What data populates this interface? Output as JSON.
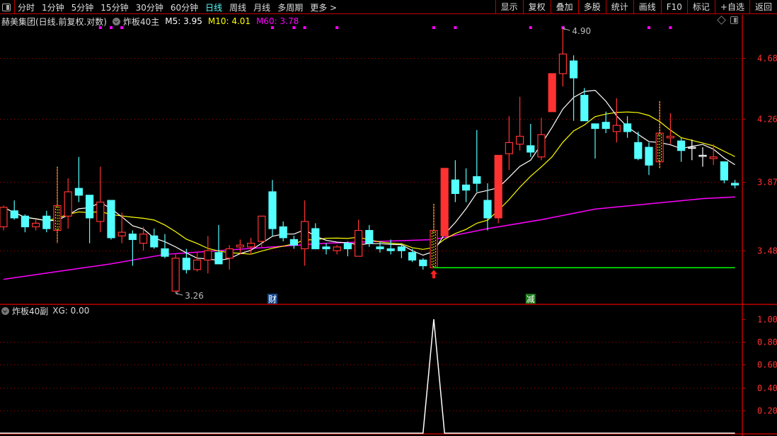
{
  "toolbar": {
    "periods": [
      "分时",
      "1分钟",
      "5分钟",
      "15分钟",
      "30分钟",
      "60分钟",
      "日线",
      "周线",
      "月线",
      "多周期",
      "更多 >"
    ],
    "active_period": "日线",
    "buttons": [
      "显示",
      "复权",
      "叠加",
      "多股",
      "统计",
      "画线",
      "F10",
      "标记",
      "+自选",
      "返回"
    ]
  },
  "main_panel": {
    "title": "赫美集团(日线.前复权.对数)",
    "indicator": "炸板40主",
    "ma5_label": "M5: 3.95",
    "ma10_label": "M10: 4.01",
    "ma60_label": "M60: 3.78"
  },
  "sub_panel": {
    "indicator": "炸板40副",
    "xg_label": "XG: 0.00"
  },
  "colors": {
    "up": "#ff3232",
    "down": "#54ffff",
    "ma5": "#ffffff",
    "ma10": "#ffff00",
    "ma60": "#ff00ff",
    "grid": "#b00000",
    "signal_line": "#00ff00"
  },
  "chart_data": [
    {
      "type": "candlestick",
      "scale": "log",
      "y_ticks": [
        "4.68",
        "4.26",
        "3.87",
        "3.48"
      ],
      "ylim": [
        3.2,
        5.0
      ],
      "candles_ohlc": [
        [
          3.61,
          3.73,
          3.59,
          3.72
        ],
        [
          3.7,
          3.76,
          3.65,
          3.66
        ],
        [
          3.67,
          3.68,
          3.58,
          3.61
        ],
        [
          3.61,
          3.65,
          3.59,
          3.63
        ],
        [
          3.67,
          3.7,
          3.58,
          3.6
        ],
        [
          3.59,
          3.96,
          3.52,
          3.73
        ],
        [
          3.67,
          3.89,
          3.6,
          3.81
        ],
        [
          3.83,
          4.02,
          3.75,
          3.79
        ],
        [
          3.79,
          3.79,
          3.52,
          3.66
        ],
        [
          3.64,
          3.96,
          3.58,
          3.75
        ],
        [
          3.76,
          3.76,
          3.54,
          3.55
        ],
        [
          3.56,
          3.69,
          3.52,
          3.58
        ],
        [
          3.57,
          3.59,
          3.4,
          3.54
        ],
        [
          3.52,
          3.61,
          3.48,
          3.57
        ],
        [
          3.56,
          3.6,
          3.49,
          3.5
        ],
        [
          3.49,
          3.57,
          3.44,
          3.45
        ],
        [
          3.27,
          3.46,
          3.26,
          3.44
        ],
        [
          3.44,
          3.49,
          3.36,
          3.38
        ],
        [
          3.38,
          3.47,
          3.37,
          3.43
        ],
        [
          3.43,
          3.56,
          3.36,
          3.48
        ],
        [
          3.47,
          3.62,
          3.41,
          3.41
        ],
        [
          3.44,
          3.51,
          3.38,
          3.49
        ],
        [
          3.5,
          3.54,
          3.46,
          3.51
        ],
        [
          3.5,
          3.55,
          3.46,
          3.52
        ],
        [
          3.53,
          3.67,
          3.5,
          3.67
        ],
        [
          3.81,
          3.88,
          3.56,
          3.6
        ],
        [
          3.61,
          3.64,
          3.53,
          3.55
        ],
        [
          3.54,
          3.56,
          3.49,
          3.51
        ],
        [
          3.49,
          3.76,
          3.4,
          3.64
        ],
        [
          3.6,
          3.63,
          3.49,
          3.49
        ],
        [
          3.5,
          3.52,
          3.46,
          3.49
        ],
        [
          3.48,
          3.51,
          3.46,
          3.5
        ],
        [
          3.52,
          3.53,
          3.45,
          3.49
        ],
        [
          3.45,
          3.65,
          3.45,
          3.59
        ],
        [
          3.59,
          3.62,
          3.5,
          3.52
        ],
        [
          3.5,
          3.53,
          3.47,
          3.49
        ],
        [
          3.49,
          3.54,
          3.46,
          3.48
        ],
        [
          3.5,
          3.52,
          3.44,
          3.48
        ],
        [
          3.47,
          3.49,
          3.42,
          3.43
        ],
        [
          3.43,
          3.44,
          3.38,
          3.4
        ],
        [
          3.39,
          3.74,
          3.39,
          3.59
        ],
        [
          3.56,
          3.95,
          3.56,
          3.95
        ],
        [
          3.88,
          4.0,
          3.75,
          3.8
        ],
        [
          3.85,
          3.95,
          3.75,
          3.82
        ],
        [
          3.9,
          4.19,
          3.81,
          3.86
        ],
        [
          3.76,
          3.86,
          3.59,
          3.66
        ],
        [
          3.66,
          4.03,
          3.63,
          4.03
        ],
        [
          4.04,
          4.28,
          3.94,
          4.11
        ],
        [
          4.1,
          4.41,
          4.06,
          4.15
        ],
        [
          4.09,
          4.23,
          4.02,
          4.05
        ],
        [
          4.02,
          4.27,
          4.0,
          4.16
        ],
        [
          4.31,
          4.57,
          4.31,
          4.57
        ],
        [
          4.57,
          4.9,
          4.48,
          4.71
        ],
        [
          4.66,
          4.7,
          4.25,
          4.54
        ],
        [
          4.42,
          4.47,
          4.25,
          4.25
        ],
        [
          4.23,
          4.23,
          4.01,
          4.2
        ],
        [
          4.24,
          4.31,
          4.17,
          4.2
        ],
        [
          4.18,
          4.4,
          4.11,
          4.22
        ],
        [
          4.23,
          4.28,
          4.14,
          4.18
        ],
        [
          4.11,
          4.18,
          4.0,
          4.01
        ],
        [
          4.08,
          4.11,
          3.91,
          3.97
        ],
        [
          3.99,
          4.38,
          3.95,
          4.17
        ],
        [
          4.14,
          4.3,
          4.1,
          4.15
        ],
        [
          4.12,
          4.14,
          3.99,
          4.06
        ],
        [
          4.08,
          4.13,
          4.0,
          4.08
        ],
        [
          4.03,
          4.08,
          3.96,
          4.03
        ],
        [
          4.01,
          4.1,
          3.97,
          4.02
        ],
        [
          3.99,
          3.99,
          3.86,
          3.88
        ],
        [
          3.86,
          3.88,
          3.83,
          3.85
        ]
      ],
      "solid_up_indices": [
        41,
        46,
        51
      ],
      "highlighted_indices": [
        5,
        40,
        61
      ],
      "marker_dot_indices": [
        9,
        10,
        11,
        25,
        27,
        28,
        31,
        40,
        42,
        49,
        52,
        60,
        62
      ],
      "ma60": [
        {
          "index": 0,
          "value": 3.33
        },
        {
          "index": 5,
          "value": 3.37
        },
        {
          "index": 10,
          "value": 3.41
        },
        {
          "index": 15,
          "value": 3.46
        },
        {
          "index": 20,
          "value": 3.48
        },
        {
          "index": 25,
          "value": 3.5
        },
        {
          "index": 30,
          "value": 3.52
        },
        {
          "index": 35,
          "value": 3.53
        },
        {
          "index": 40,
          "value": 3.54
        },
        {
          "index": 45,
          "value": 3.6
        },
        {
          "index": 50,
          "value": 3.65
        },
        {
          "index": 55,
          "value": 3.71
        },
        {
          "index": 60,
          "value": 3.74
        },
        {
          "index": 65,
          "value": 3.77
        },
        {
          "index": 68,
          "value": 3.78
        }
      ],
      "annotations": {
        "high": {
          "index": 52,
          "label": "4.90"
        },
        "low": {
          "index": 16,
          "label": "3.26"
        },
        "buy_arrow_index": 40,
        "signal_line": {
          "from_index": 40,
          "value": 3.39
        }
      },
      "event_markers": [
        {
          "index": 25,
          "label": "财",
          "color": "#1a4a8a"
        },
        {
          "index": 49,
          "label": "减",
          "color": "#1a7a1a"
        }
      ]
    },
    {
      "type": "line",
      "series": [
        {
          "name": "XG",
          "spike_index": 40,
          "spike_value": 1.0,
          "baseline": 0.0
        }
      ],
      "y_ticks": [
        "1.00",
        "0.80",
        "0.60",
        "0.40",
        "0.20"
      ],
      "ylim": [
        0,
        1.0
      ]
    }
  ]
}
